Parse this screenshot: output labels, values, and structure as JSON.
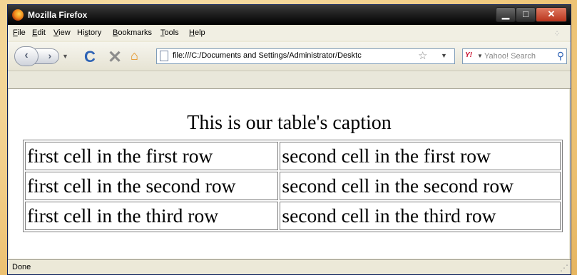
{
  "window": {
    "title": "Mozilla Firefox"
  },
  "menu": [
    "File",
    "Edit",
    "View",
    "History",
    "Bookmarks",
    "Tools",
    "Help"
  ],
  "menu_underline": [
    "F",
    "E",
    "V",
    "s",
    "B",
    "T",
    "H"
  ],
  "nav": {
    "url": "file:///C:/Documents and Settings/Administrator/Desktc",
    "search_placeholder": "Yahoo! Search",
    "search_engine_badge": "Y!"
  },
  "page": {
    "caption": "This is our table's caption",
    "rows": [
      [
        "first cell in the first row",
        "second cell in the first row"
      ],
      [
        "first cell in the second row",
        "second cell in the second row"
      ],
      [
        "first cell in the third row",
        "second cell in the third row"
      ]
    ]
  },
  "status": {
    "text": "Done"
  },
  "icons": [
    "firefox-logo-icon",
    "minimize-icon",
    "maximize-icon",
    "close-icon",
    "back-icon",
    "forward-icon",
    "reload-icon",
    "stop-icon",
    "home-icon",
    "page-icon",
    "bookmark-star-icon",
    "search-magnifier-icon"
  ]
}
